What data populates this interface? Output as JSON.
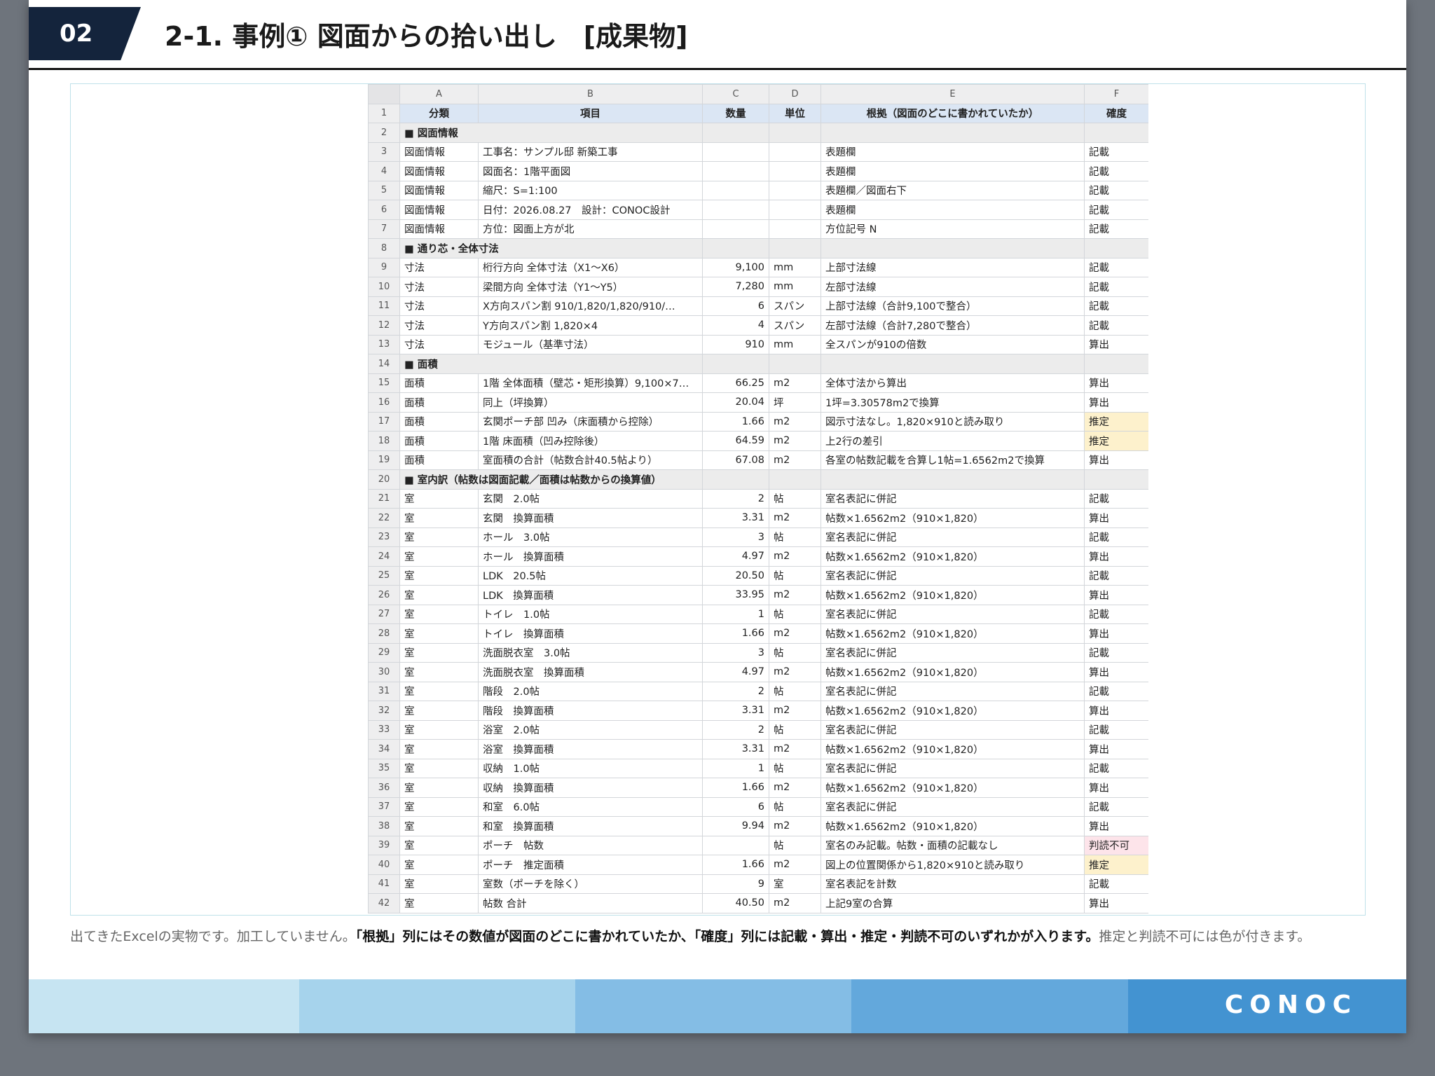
{
  "header": {
    "section_number": "02",
    "title": "2-1. 事例① 図面からの拾い出し　[成果物]"
  },
  "sheet": {
    "column_letters": [
      "A",
      "B",
      "C",
      "D",
      "E",
      "F"
    ],
    "header_row": {
      "num": "1",
      "cells": [
        "分類",
        "項目",
        "数量",
        "単位",
        "根拠（図面のどこに書かれていたか）",
        "確度"
      ]
    },
    "rows": [
      {
        "num": "2",
        "section": "■ 図面情報"
      },
      {
        "num": "3",
        "cells": [
          "図面情報",
          "工事名：サンプル邸 新築工事",
          "",
          "",
          "表題欄",
          "記載"
        ]
      },
      {
        "num": "4",
        "cells": [
          "図面情報",
          "図面名：1階平面図",
          "",
          "",
          "表題欄",
          "記載"
        ]
      },
      {
        "num": "5",
        "cells": [
          "図面情報",
          "縮尺：S=1:100",
          "",
          "",
          "表題欄／図面右下",
          "記載"
        ]
      },
      {
        "num": "6",
        "cells": [
          "図面情報",
          "日付：2026.08.27　設計：CONOC設計",
          "",
          "",
          "表題欄",
          "記載"
        ]
      },
      {
        "num": "7",
        "cells": [
          "図面情報",
          "方位：図面上方が北",
          "",
          "",
          "方位記号 N",
          "記載"
        ]
      },
      {
        "num": "8",
        "section": "■ 通り芯・全体寸法"
      },
      {
        "num": "9",
        "cells": [
          "寸法",
          "桁行方向 全体寸法（X1〜X6）",
          "9,100",
          "mm",
          "上部寸法線",
          "記載"
        ]
      },
      {
        "num": "10",
        "cells": [
          "寸法",
          "梁間方向 全体寸法（Y1〜Y5）",
          "7,280",
          "mm",
          "左部寸法線",
          "記載"
        ]
      },
      {
        "num": "11",
        "cells": [
          "寸法",
          "X方向スパン割 910/1,820/1,820/910/…",
          "6",
          "スパン",
          "上部寸法線（合計9,100で整合）",
          "記載"
        ]
      },
      {
        "num": "12",
        "cells": [
          "寸法",
          "Y方向スパン割 1,820×4",
          "4",
          "スパン",
          "左部寸法線（合計7,280で整合）",
          "記載"
        ]
      },
      {
        "num": "13",
        "cells": [
          "寸法",
          "モジュール（基準寸法）",
          "910",
          "mm",
          "全スパンが910の倍数",
          "算出"
        ]
      },
      {
        "num": "14",
        "section": "■ 面積"
      },
      {
        "num": "15",
        "cells": [
          "面積",
          "1階 全体面積（壁芯・矩形換算）9,100×7…",
          "66.25",
          "m2",
          "全体寸法から算出",
          "算出"
        ]
      },
      {
        "num": "16",
        "cells": [
          "面積",
          "同上（坪換算）",
          "20.04",
          "坪",
          "1坪=3.30578m2で換算",
          "算出"
        ]
      },
      {
        "num": "17",
        "cells": [
          "面積",
          "玄関ポーチ部 凹み（床面積から控除）",
          "1.66",
          "m2",
          "図示寸法なし。1,820×910と読み取り",
          "推定"
        ]
      },
      {
        "num": "18",
        "cells": [
          "面積",
          "1階 床面積（凹み控除後）",
          "64.59",
          "m2",
          "上2行の差引",
          "推定"
        ]
      },
      {
        "num": "19",
        "cells": [
          "面積",
          "室面積の合計（帖数合計40.5帖より）",
          "67.08",
          "m2",
          "各室の帖数記載を合算し1帖=1.6562m2で換算",
          "算出"
        ]
      },
      {
        "num": "20",
        "section": "■ 室内訳（帖数は図面記載／面積は帖数からの換算値）"
      },
      {
        "num": "21",
        "cells": [
          "室",
          "玄関　2.0帖",
          "2",
          "帖",
          "室名表記に併記",
          "記載"
        ]
      },
      {
        "num": "22",
        "cells": [
          "室",
          "玄関　換算面積",
          "3.31",
          "m2",
          "帖数×1.6562m2（910×1,820）",
          "算出"
        ]
      },
      {
        "num": "23",
        "cells": [
          "室",
          "ホール　3.0帖",
          "3",
          "帖",
          "室名表記に併記",
          "記載"
        ]
      },
      {
        "num": "24",
        "cells": [
          "室",
          "ホール　換算面積",
          "4.97",
          "m2",
          "帖数×1.6562m2（910×1,820）",
          "算出"
        ]
      },
      {
        "num": "25",
        "cells": [
          "室",
          "LDK　20.5帖",
          "20.50",
          "帖",
          "室名表記に併記",
          "記載"
        ]
      },
      {
        "num": "26",
        "cells": [
          "室",
          "LDK　換算面積",
          "33.95",
          "m2",
          "帖数×1.6562m2（910×1,820）",
          "算出"
        ]
      },
      {
        "num": "27",
        "cells": [
          "室",
          "トイレ　1.0帖",
          "1",
          "帖",
          "室名表記に併記",
          "記載"
        ]
      },
      {
        "num": "28",
        "cells": [
          "室",
          "トイレ　換算面積",
          "1.66",
          "m2",
          "帖数×1.6562m2（910×1,820）",
          "算出"
        ]
      },
      {
        "num": "29",
        "cells": [
          "室",
          "洗面脱衣室　3.0帖",
          "3",
          "帖",
          "室名表記に併記",
          "記載"
        ]
      },
      {
        "num": "30",
        "cells": [
          "室",
          "洗面脱衣室　換算面積",
          "4.97",
          "m2",
          "帖数×1.6562m2（910×1,820）",
          "算出"
        ]
      },
      {
        "num": "31",
        "cells": [
          "室",
          "階段　2.0帖",
          "2",
          "帖",
          "室名表記に併記",
          "記載"
        ]
      },
      {
        "num": "32",
        "cells": [
          "室",
          "階段　換算面積",
          "3.31",
          "m2",
          "帖数×1.6562m2（910×1,820）",
          "算出"
        ]
      },
      {
        "num": "33",
        "cells": [
          "室",
          "浴室　2.0帖",
          "2",
          "帖",
          "室名表記に併記",
          "記載"
        ]
      },
      {
        "num": "34",
        "cells": [
          "室",
          "浴室　換算面積",
          "3.31",
          "m2",
          "帖数×1.6562m2（910×1,820）",
          "算出"
        ]
      },
      {
        "num": "35",
        "cells": [
          "室",
          "収納　1.0帖",
          "1",
          "帖",
          "室名表記に併記",
          "記載"
        ]
      },
      {
        "num": "36",
        "cells": [
          "室",
          "収納　換算面積",
          "1.66",
          "m2",
          "帖数×1.6562m2（910×1,820）",
          "算出"
        ]
      },
      {
        "num": "37",
        "cells": [
          "室",
          "和室　6.0帖",
          "6",
          "帖",
          "室名表記に併記",
          "記載"
        ]
      },
      {
        "num": "38",
        "cells": [
          "室",
          "和室　換算面積",
          "9.94",
          "m2",
          "帖数×1.6562m2（910×1,820）",
          "算出"
        ]
      },
      {
        "num": "39",
        "cells": [
          "室",
          "ポーチ　帖数",
          "",
          "帖",
          "室名のみ記載。帖数・面積の記載なし",
          "判読不可"
        ]
      },
      {
        "num": "40",
        "cells": [
          "室",
          "ポーチ　推定面積",
          "1.66",
          "m2",
          "図上の位置関係から1,820×910と読み取り",
          "推定"
        ]
      },
      {
        "num": "41",
        "cells": [
          "室",
          "室数（ポーチを除く）",
          "9",
          "室",
          "室名表記を計数",
          "記載"
        ]
      },
      {
        "num": "42",
        "cells": [
          "室",
          "帖数 合計",
          "40.50",
          "m2",
          "上記9室の合算",
          "算出"
        ]
      }
    ]
  },
  "caption": {
    "part1": "出てきたExcelの実物です。加工していません。",
    "part2": "「根拠」列にはその数値が図面のどこに書かれていたか、「確度」列には記載・算出・推定・判読不可のいずれかが入ります。",
    "part3": "推定と判読不可には色が付きます。"
  },
  "footer": {
    "logo": "CONOC",
    "band_colors": [
      "#c6e4f2",
      "#a6d3ec",
      "#84bde5",
      "#63a8dc",
      "#4393d1"
    ]
  },
  "colors": {
    "title_badge": "#14243c",
    "header_fill": "#dbe6f4",
    "estimate_fill": "#fdf1cc",
    "illegible_fill": "#fde4ea"
  }
}
